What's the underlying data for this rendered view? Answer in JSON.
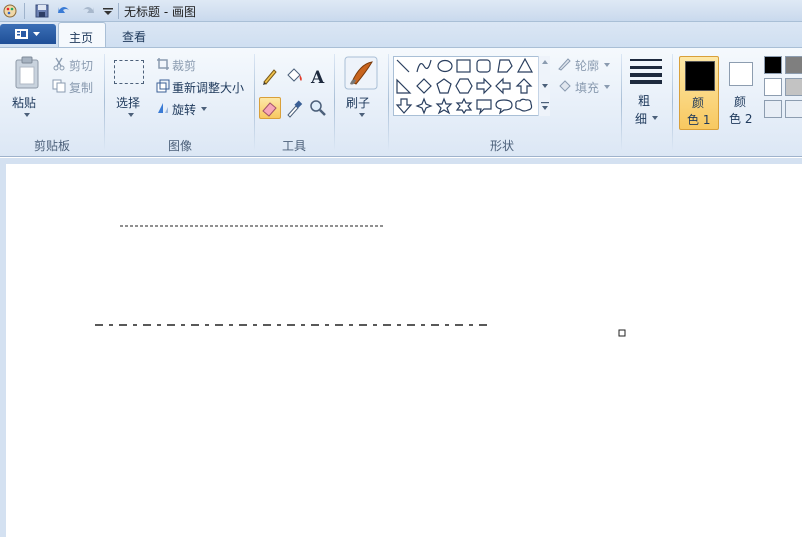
{
  "window": {
    "title": "无标题 - 画图"
  },
  "quick_access": {
    "save": "save-icon",
    "undo": "undo-icon",
    "redo": "redo-icon",
    "customize": "dropdown-icon"
  },
  "tabs": [
    {
      "label": "主页"
    },
    {
      "label": "查看"
    }
  ],
  "ribbon": {
    "clipboard": {
      "paste": "粘贴",
      "cut": "剪切",
      "copy": "复制",
      "group": "剪贴板"
    },
    "image": {
      "select": "选择",
      "crop": "裁剪",
      "resize": "重新调整大小",
      "rotate": "旋转",
      "group": "图像"
    },
    "tools": {
      "group": "工具"
    },
    "brush": {
      "label": "刷子"
    },
    "shapes": {
      "outline": "轮廓",
      "fill": "填充",
      "group": "形状"
    },
    "size": {
      "label1": "粗",
      "label2": "细"
    },
    "color1": {
      "label1": "颜",
      "label2": "色 1"
    },
    "color2": {
      "label1": "颜",
      "label2": "色 2"
    },
    "accent": "#f8d27a",
    "palette": [
      "#000000",
      "#7f7f7f",
      "#ffffff",
      "#c3c3c3",
      "#ffffff",
      "#ffffff"
    ]
  }
}
